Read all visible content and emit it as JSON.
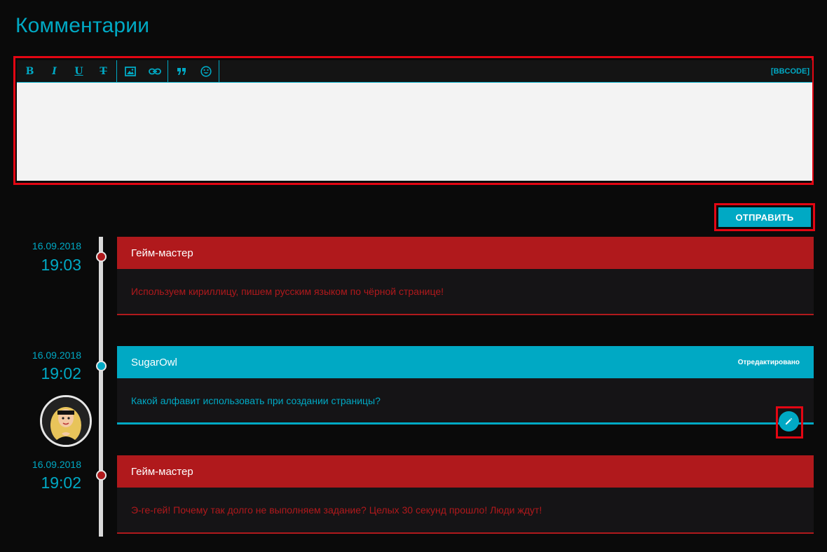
{
  "page": {
    "title": "Комментарии"
  },
  "editor": {
    "toolbar": {
      "bold": "B",
      "italic": "I",
      "underline": "U",
      "strike": "T",
      "icons": [
        "bold-icon",
        "italic-icon",
        "underline-icon",
        "strikethrough-icon",
        "image-icon",
        "link-icon",
        "quote-icon",
        "smiley-icon"
      ],
      "bbcode_label": "[BBCODE]"
    },
    "value": ""
  },
  "send": {
    "label": "ОТПРАВИТЬ"
  },
  "colors": {
    "accent": "#00a9c4",
    "gm_red": "#b0191c",
    "highlight": "#e30613",
    "background": "#0a0a0a"
  },
  "comments": [
    {
      "date": "16.09.2018",
      "time": "19:03",
      "author": "Гейм-мастер",
      "text": "Используем кириллицу, пишем русским языком по чёрной странице!",
      "style": "red"
    },
    {
      "date": "16.09.2018",
      "time": "19:02",
      "author": "SugarOwl",
      "edited": "Отредактировано",
      "text": "Какой алфавит использовать при создании страницы?",
      "style": "blue",
      "has_avatar": true,
      "has_edit_button": true
    },
    {
      "date": "16.09.2018",
      "time": "19:02",
      "author": "Гейм-мастер",
      "text": "Э-ге-гей! Почему так долго не выполняем задание? Целых 30 секунд прошло! Люди ждут!",
      "style": "red"
    }
  ]
}
